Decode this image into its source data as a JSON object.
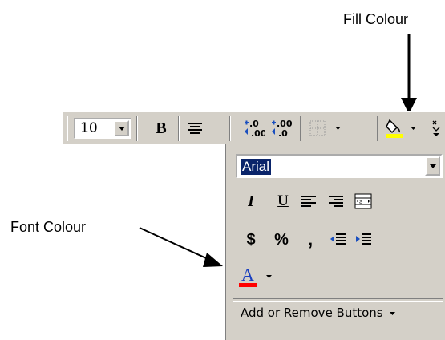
{
  "callouts": {
    "fill_colour": "Fill Colour",
    "font_colour": "Font Colour"
  },
  "toolbar": {
    "font_size": "10",
    "bold_glyph": "B",
    "increase_decimal": ".00",
    "decrease_decimal": ".00",
    "increase_decimal_lead": "+.0",
    "decrease_decimal_lead": "+.0"
  },
  "panel": {
    "font_name": "Arial",
    "italic": "I",
    "underline": "U",
    "currency": "$",
    "percent": "%",
    "comma": ",",
    "font_colour_glyph": "A",
    "add_remove": "Add or Remove Buttons"
  },
  "colors": {
    "fill_colour": "#ffff00",
    "font_colour": "#ff0000",
    "toolbar_bg": "#d4d0c8",
    "selection": "#0a246a"
  },
  "icons": [
    "align-center-icon",
    "borders-icon",
    "fill-bucket-icon",
    "align-left-icon",
    "align-right-icon",
    "merge-center-icon",
    "decrease-indent-icon",
    "increase-indent-icon",
    "chevron-down-icon",
    "toolbar-options-icon"
  ]
}
